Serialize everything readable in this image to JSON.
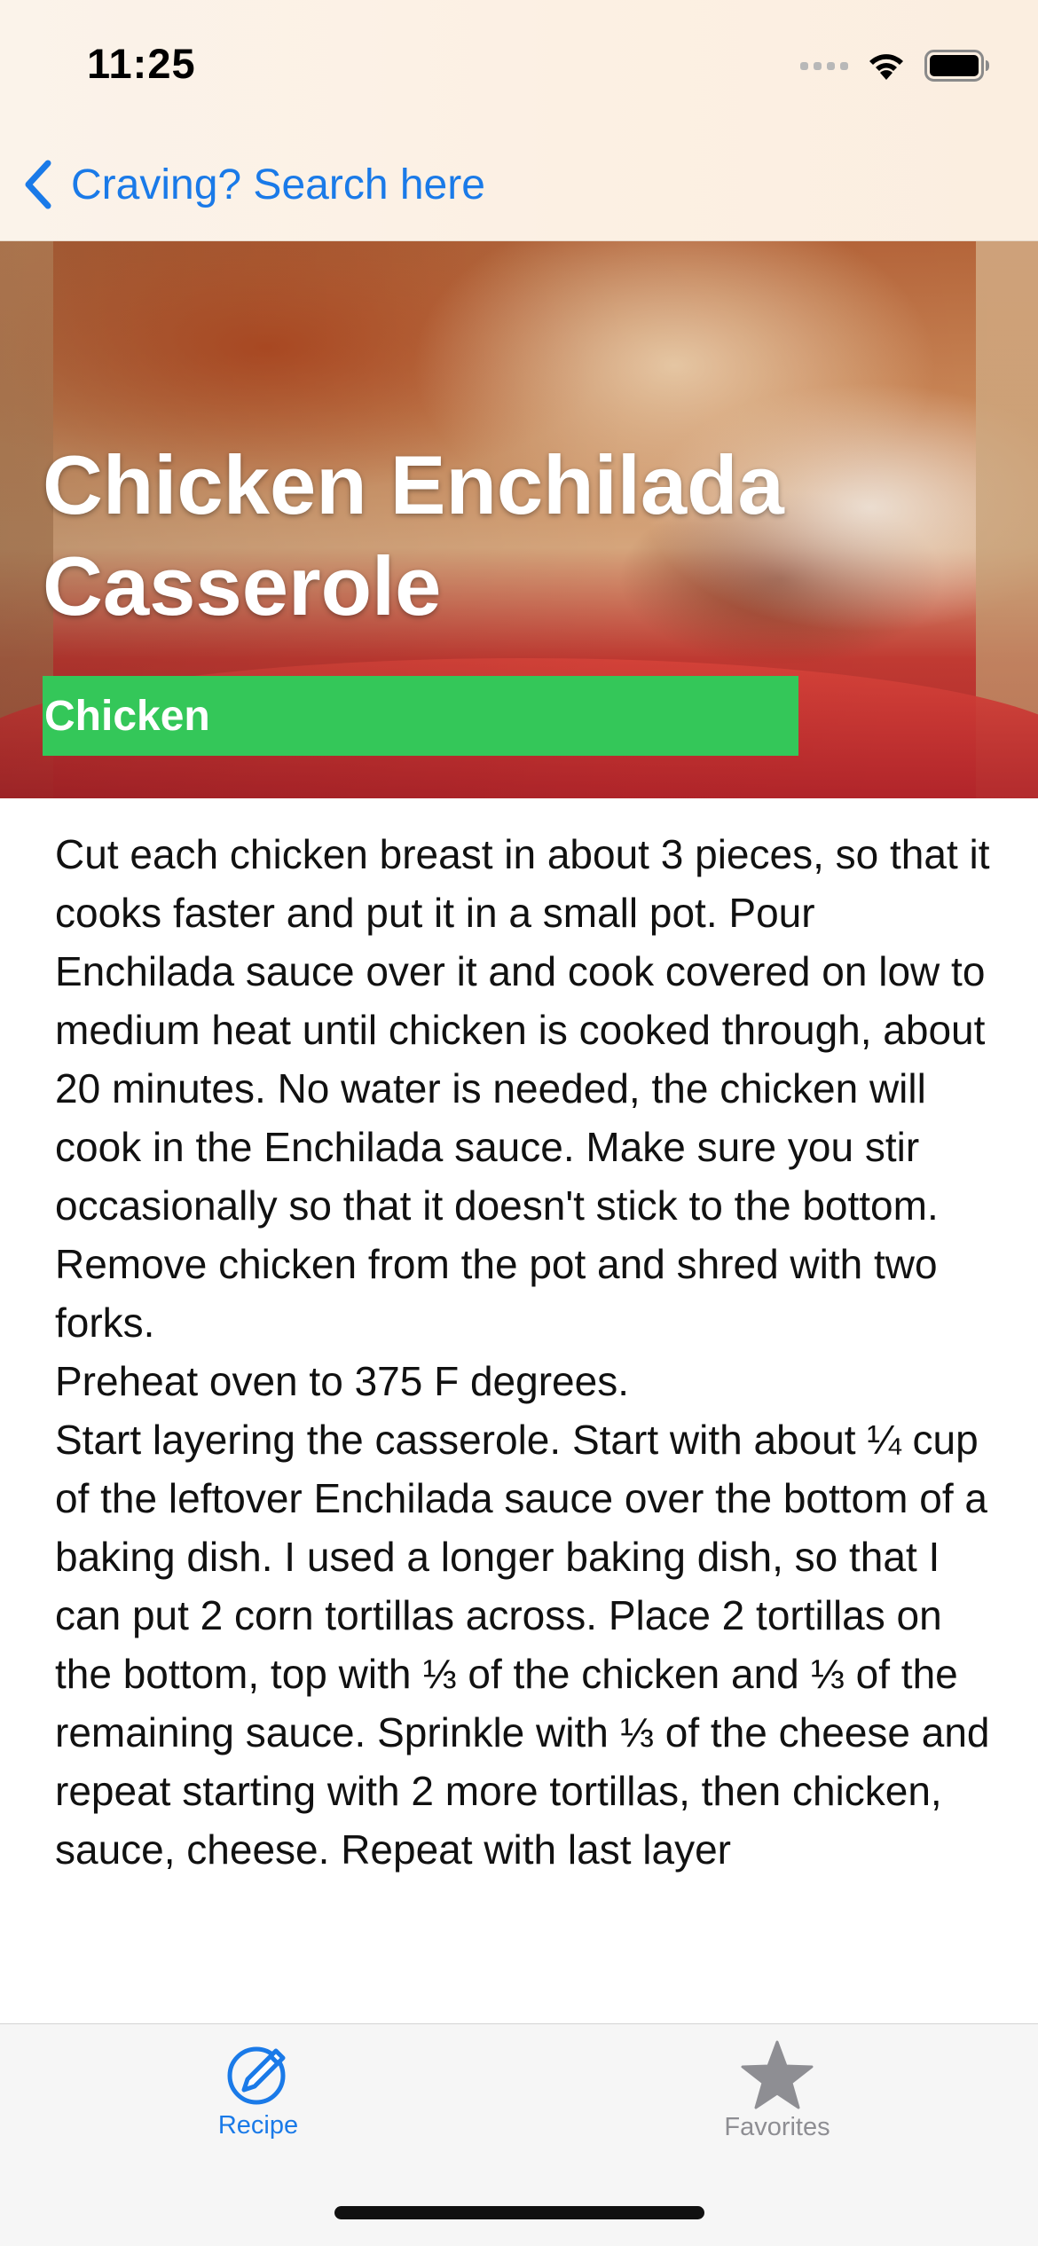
{
  "status_bar": {
    "time": "11:25"
  },
  "nav": {
    "back_label": "Craving? Search here"
  },
  "recipe": {
    "title": "Chicken Enchilada Casserole",
    "category": "Chicken",
    "category_color": "#34c759",
    "instructions": [
      "Cut each chicken breast in about 3 pieces, so that it cooks faster and put it in a small pot. Pour Enchilada sauce over it and cook covered on low to medium heat until chicken is cooked through, about 20 minutes. No water is needed, the chicken will cook in the Enchilada sauce. Make sure you stir occasionally so that it doesn't stick to the bottom.",
      "Remove chicken from the pot and shred with two forks.",
      "Preheat oven to 375 F degrees.",
      "Start layering the casserole. Start with about ¼ cup of the leftover Enchilada sauce over the bottom of a baking dish. I used a longer baking dish, so that I can put 2 corn tortillas across. Place 2 tortillas on the bottom, top with ⅓ of the chicken and ⅓ of the remaining sauce. Sprinkle with ⅓ of the cheese and repeat starting with 2 more tortillas, then chicken, sauce, cheese. Repeat with last layer"
    ]
  },
  "tabbar": {
    "tabs": [
      {
        "label": "Recipe",
        "icon": "compass-pen-icon",
        "selected": true
      },
      {
        "label": "Favorites",
        "icon": "star-icon",
        "selected": false
      }
    ],
    "active_color": "#1a7ae8",
    "inactive_color": "#8e8e93"
  }
}
